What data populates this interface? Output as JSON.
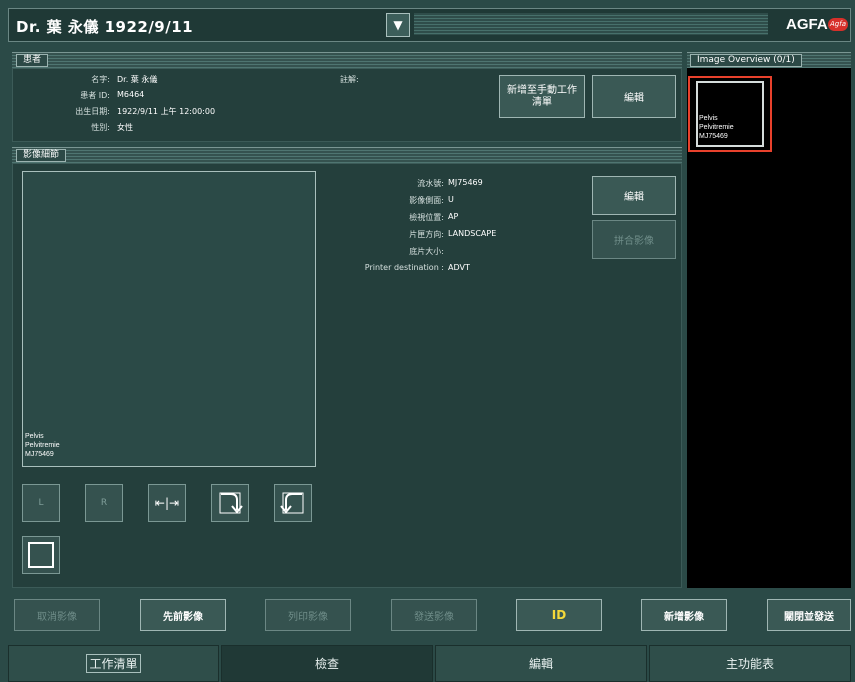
{
  "title": {
    "patient_line": "Dr. 葉 永儀  1922/9/11",
    "dropdown_icon": "▼",
    "brand": "AGFA",
    "brand_mark": "Agfa"
  },
  "patient": {
    "section_label": "患者",
    "name_label": "名字:",
    "name_value": "Dr. 葉 永儀",
    "id_label": "患者 ID:",
    "id_value": "M6464",
    "dob_label": "出生日期:",
    "dob_value": "1922/9/11 上午 12:00:00",
    "sex_label": "性別:",
    "sex_value": "女性",
    "note_label": "註解:",
    "add_worklist_button": "新增至手動工作清單",
    "edit_button": "編輯"
  },
  "image_details": {
    "section_label": "影像細節",
    "preview_caption": [
      "Pelvis",
      "Pelvitremie",
      "MJ75469"
    ],
    "fields": [
      {
        "label": "流水號:",
        "value": "MJ75469"
      },
      {
        "label": "影像側面:",
        "value": "U"
      },
      {
        "label": "檢視位置:",
        "value": "AP"
      },
      {
        "label": "片匣方向:",
        "value": "LANDSCAPE"
      },
      {
        "label": "底片大小:",
        "value": ""
      },
      {
        "label": "Printer destination :",
        "value": "ADVT"
      }
    ],
    "edit_button": "編輯",
    "stitch_button": "拼合影像",
    "left_marker": "L",
    "right_marker": "R",
    "flip_icon": "⇤|⇥"
  },
  "overview": {
    "title": "Image Overview (0/1)",
    "thumb_caption": [
      "Pelvis",
      "Pelvitremie",
      "MJ75469"
    ]
  },
  "actions": {
    "cancel_image": "取消影像",
    "prev_image": "先前影像",
    "print_image": "列印影像",
    "send_image": "發送影像",
    "id": "ID",
    "new_image": "新增影像",
    "close_send": "關閉並發送"
  },
  "tabs": [
    "工作清單",
    "檢查",
    "編輯",
    "主功能表"
  ],
  "colors": {
    "background": "#2b4a47",
    "panel": "#243f3c",
    "overview_bg": "#000000",
    "highlight": "#e8412c"
  }
}
